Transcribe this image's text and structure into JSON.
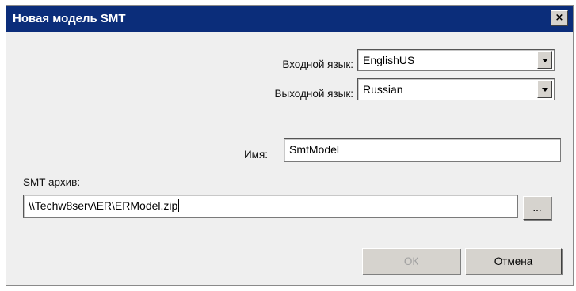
{
  "window": {
    "title": "Новая модель SMT",
    "close_symbol": "×"
  },
  "form": {
    "input_language": {
      "label": "Входной язык:",
      "value": "EnglishUS"
    },
    "output_language": {
      "label": "Выходной язык:",
      "value": "Russian"
    },
    "name": {
      "label": "Имя:",
      "value": "SmtModel"
    },
    "archive": {
      "label": "SMT архив:",
      "value": "\\\\Techw8serv\\ER\\ERModel.zip"
    },
    "browse_label": "..."
  },
  "buttons": {
    "ok": "ОК",
    "cancel": "Отмена"
  },
  "colors": {
    "titlebar": "#0b2d7a",
    "dialog_bg": "#efefef"
  }
}
